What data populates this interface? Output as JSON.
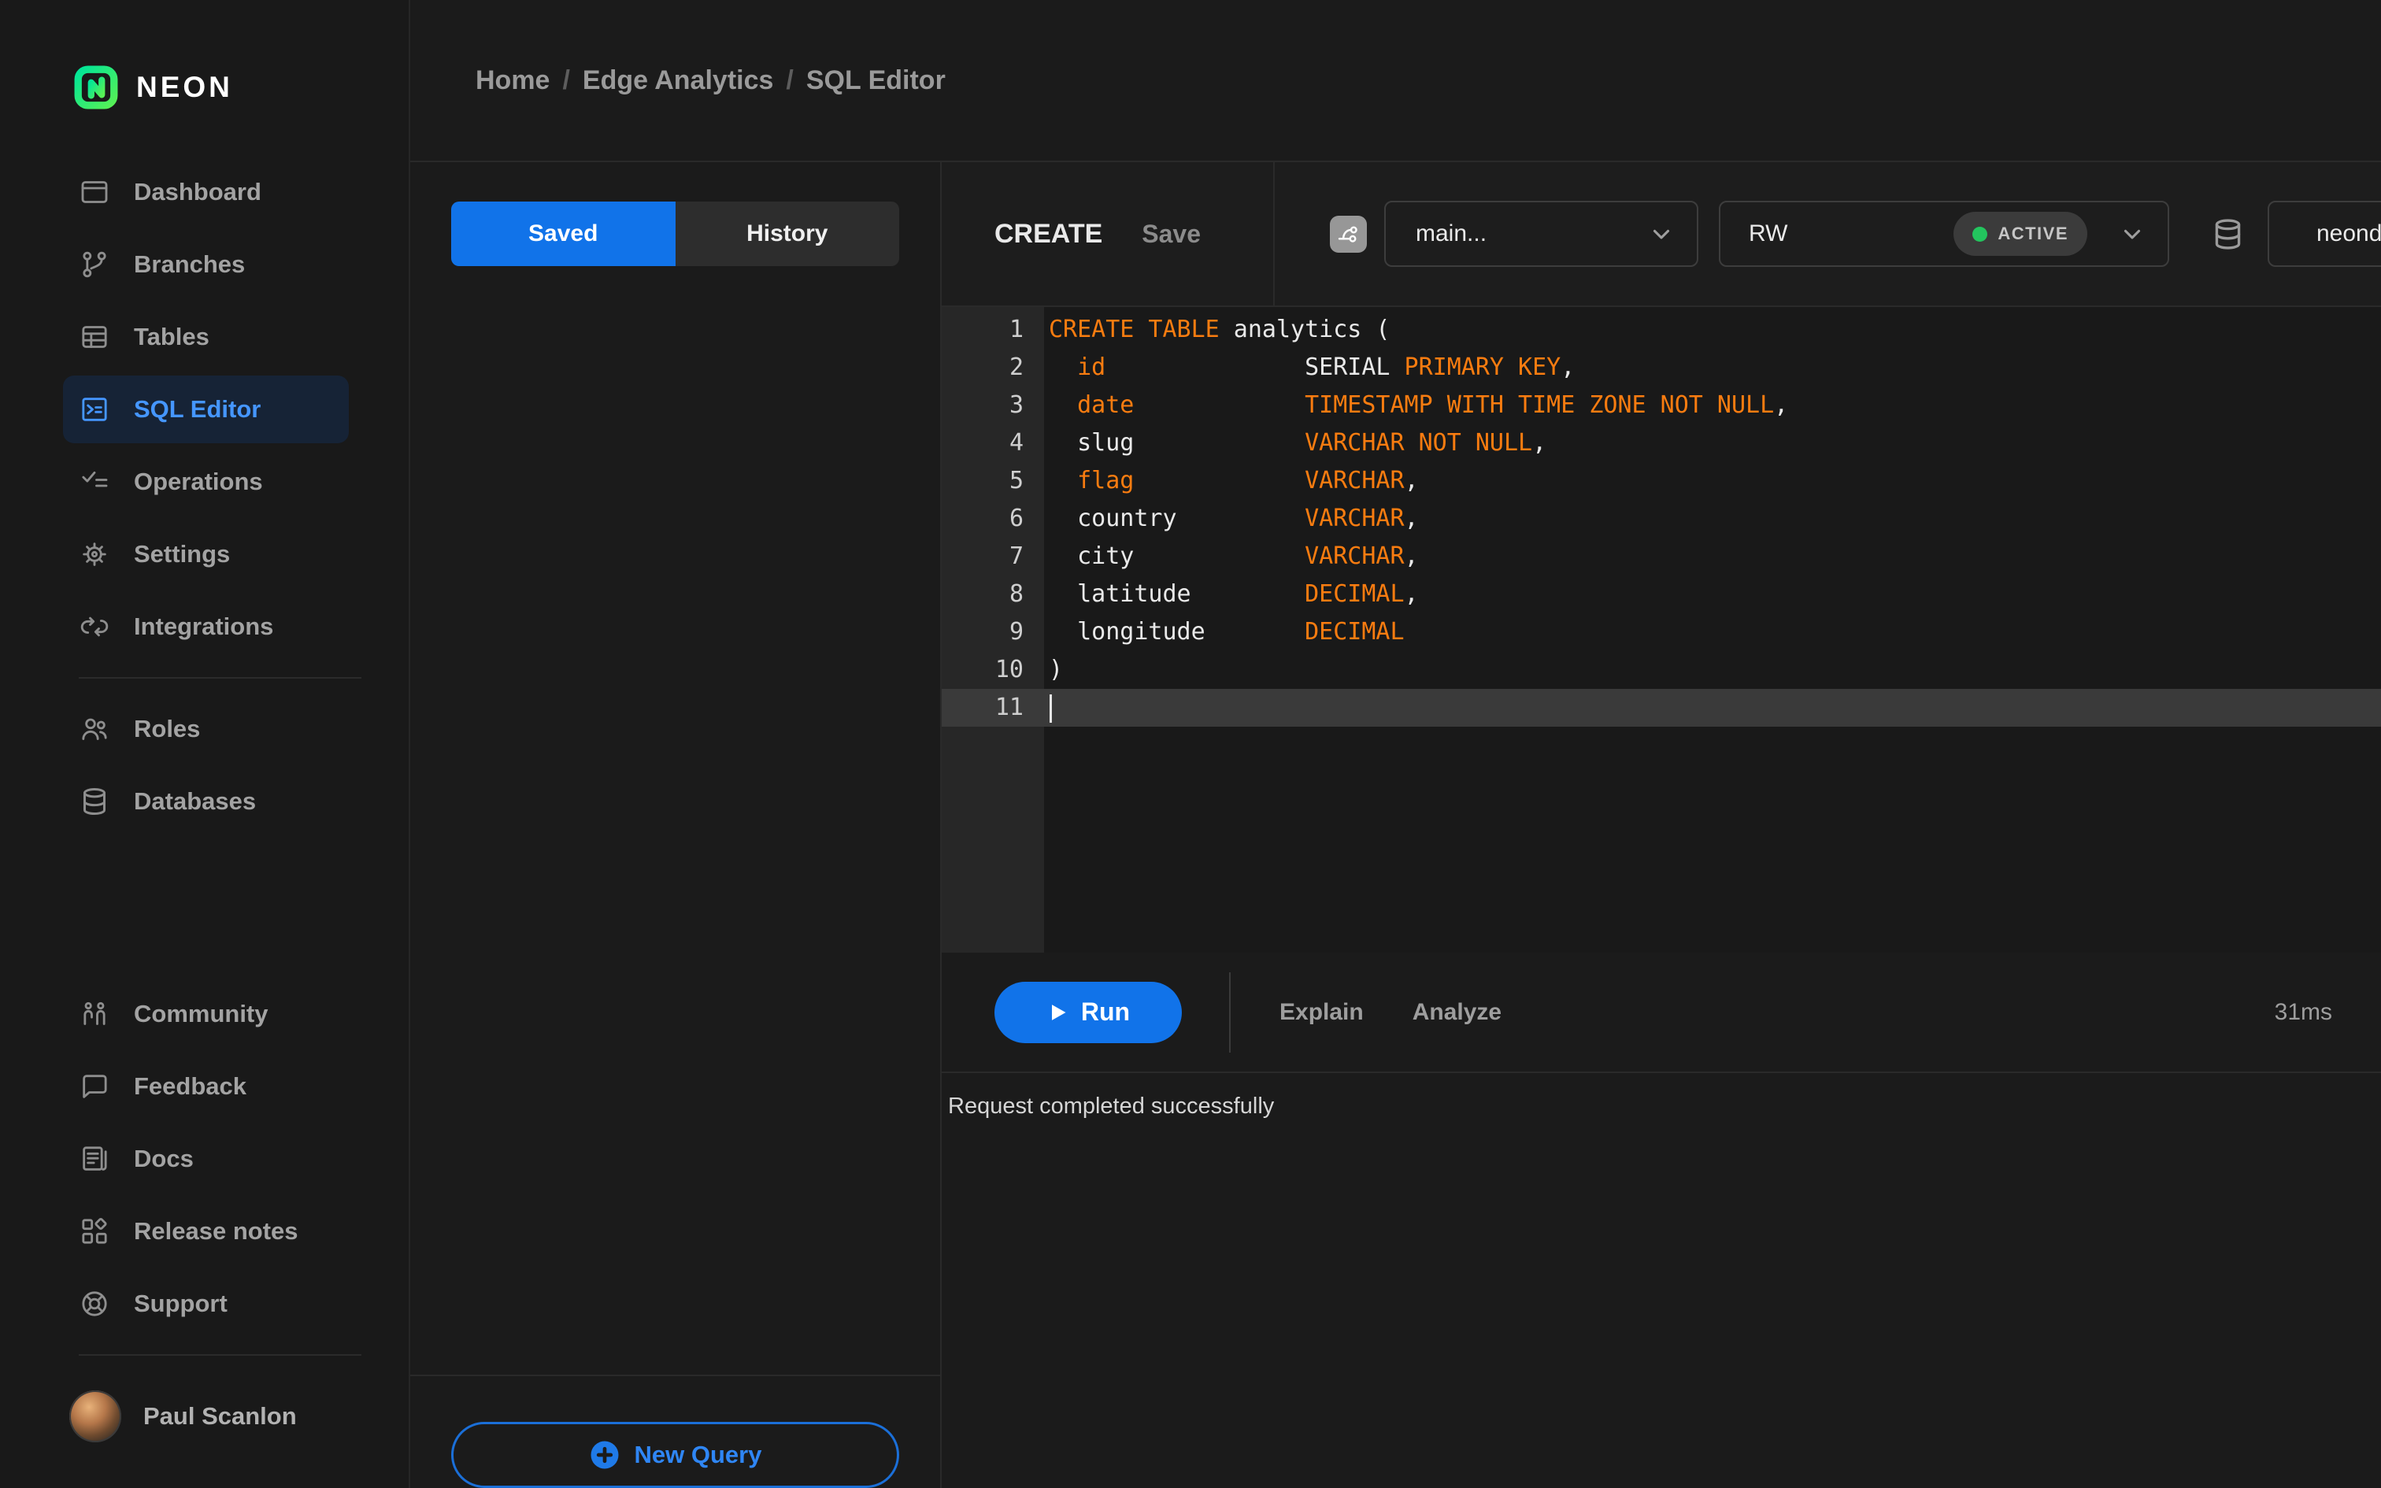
{
  "brand": {
    "name": "NEON"
  },
  "sidebar": {
    "sections": {
      "primary": [
        {
          "id": "dashboard",
          "label": "Dashboard",
          "icon": "dashboard",
          "active": false
        },
        {
          "id": "branches",
          "label": "Branches",
          "icon": "git-branch",
          "active": false
        },
        {
          "id": "tables",
          "label": "Tables",
          "icon": "table",
          "active": false
        },
        {
          "id": "sql-editor",
          "label": "SQL Editor",
          "icon": "terminal-square",
          "active": true
        },
        {
          "id": "operations",
          "label": "Operations",
          "icon": "checklist",
          "active": false
        },
        {
          "id": "settings",
          "label": "Settings",
          "icon": "gear",
          "active": false
        },
        {
          "id": "integrations",
          "label": "Integrations",
          "icon": "integrations",
          "active": false
        }
      ],
      "data": [
        {
          "id": "roles",
          "label": "Roles",
          "icon": "users",
          "active": false
        },
        {
          "id": "databases",
          "label": "Databases",
          "icon": "database",
          "active": false
        }
      ],
      "resources": [
        {
          "id": "community",
          "label": "Community",
          "icon": "community",
          "active": false
        },
        {
          "id": "feedback",
          "label": "Feedback",
          "icon": "message-square",
          "active": false
        },
        {
          "id": "docs",
          "label": "Docs",
          "icon": "docs",
          "active": false
        },
        {
          "id": "release-notes",
          "label": "Release notes",
          "icon": "release-notes",
          "active": false
        },
        {
          "id": "support",
          "label": "Support",
          "icon": "life-buoy",
          "active": false
        }
      ]
    },
    "user": {
      "name": "Paul Scanlon"
    }
  },
  "breadcrumb": {
    "items": [
      "Home",
      "Edge Analytics",
      "SQL Editor"
    ],
    "separator": "/"
  },
  "queries_panel": {
    "tabs": [
      {
        "label": "Saved",
        "active": true
      },
      {
        "label": "History",
        "active": false
      }
    ],
    "new_query_label": "New Query"
  },
  "editor": {
    "query_tab": "CREATE",
    "save_label": "Save",
    "branch": {
      "value": "main...",
      "icon": "git-merge"
    },
    "compute": {
      "value": "RW",
      "status_badge": "ACTIVE"
    },
    "database": {
      "value": "neondb",
      "icon": "database"
    },
    "code": {
      "active_line": 11,
      "lines": [
        {
          "n": 1,
          "tokens": [
            [
              "k",
              "CREATE TABLE"
            ],
            [
              "p",
              " analytics ("
            ]
          ]
        },
        {
          "n": 2,
          "tokens": [
            [
              "p",
              "  "
            ],
            [
              "k",
              "id"
            ],
            [
              "p",
              "              SERIAL "
            ],
            [
              "k",
              "PRIMARY KEY"
            ],
            [
              "p",
              ","
            ]
          ]
        },
        {
          "n": 3,
          "tokens": [
            [
              "p",
              "  "
            ],
            [
              "k",
              "date"
            ],
            [
              "p",
              "            "
            ],
            [
              "k",
              "TIMESTAMP WITH TIME ZONE NOT NULL"
            ],
            [
              "p",
              ","
            ]
          ]
        },
        {
          "n": 4,
          "tokens": [
            [
              "p",
              "  slug            "
            ],
            [
              "k",
              "VARCHAR NOT NULL"
            ],
            [
              "p",
              ","
            ]
          ]
        },
        {
          "n": 5,
          "tokens": [
            [
              "p",
              "  "
            ],
            [
              "k",
              "flag"
            ],
            [
              "p",
              "            "
            ],
            [
              "k",
              "VARCHAR"
            ],
            [
              "p",
              ","
            ]
          ]
        },
        {
          "n": 6,
          "tokens": [
            [
              "p",
              "  country         "
            ],
            [
              "k",
              "VARCHAR"
            ],
            [
              "p",
              ","
            ]
          ]
        },
        {
          "n": 7,
          "tokens": [
            [
              "p",
              "  city            "
            ],
            [
              "k",
              "VARCHAR"
            ],
            [
              "p",
              ","
            ]
          ]
        },
        {
          "n": 8,
          "tokens": [
            [
              "p",
              "  latitude        "
            ],
            [
              "k",
              "DECIMAL"
            ],
            [
              "p",
              ","
            ]
          ]
        },
        {
          "n": 9,
          "tokens": [
            [
              "p",
              "  longitude       "
            ],
            [
              "k",
              "DECIMAL"
            ]
          ]
        },
        {
          "n": 10,
          "tokens": [
            [
              "p",
              ")"
            ]
          ]
        },
        {
          "n": 11,
          "tokens": []
        }
      ]
    }
  },
  "run_bar": {
    "run_label": "Run",
    "explain_label": "Explain",
    "analyze_label": "Analyze",
    "duration": "31ms"
  },
  "status": {
    "message": "Request completed successfully"
  },
  "colors": {
    "accent_blue": "#1173e9",
    "keyword_orange": "#f97c10",
    "active_nav_blue": "#4596ff",
    "status_green": "#23c55e",
    "logo_green": "#00e599"
  }
}
